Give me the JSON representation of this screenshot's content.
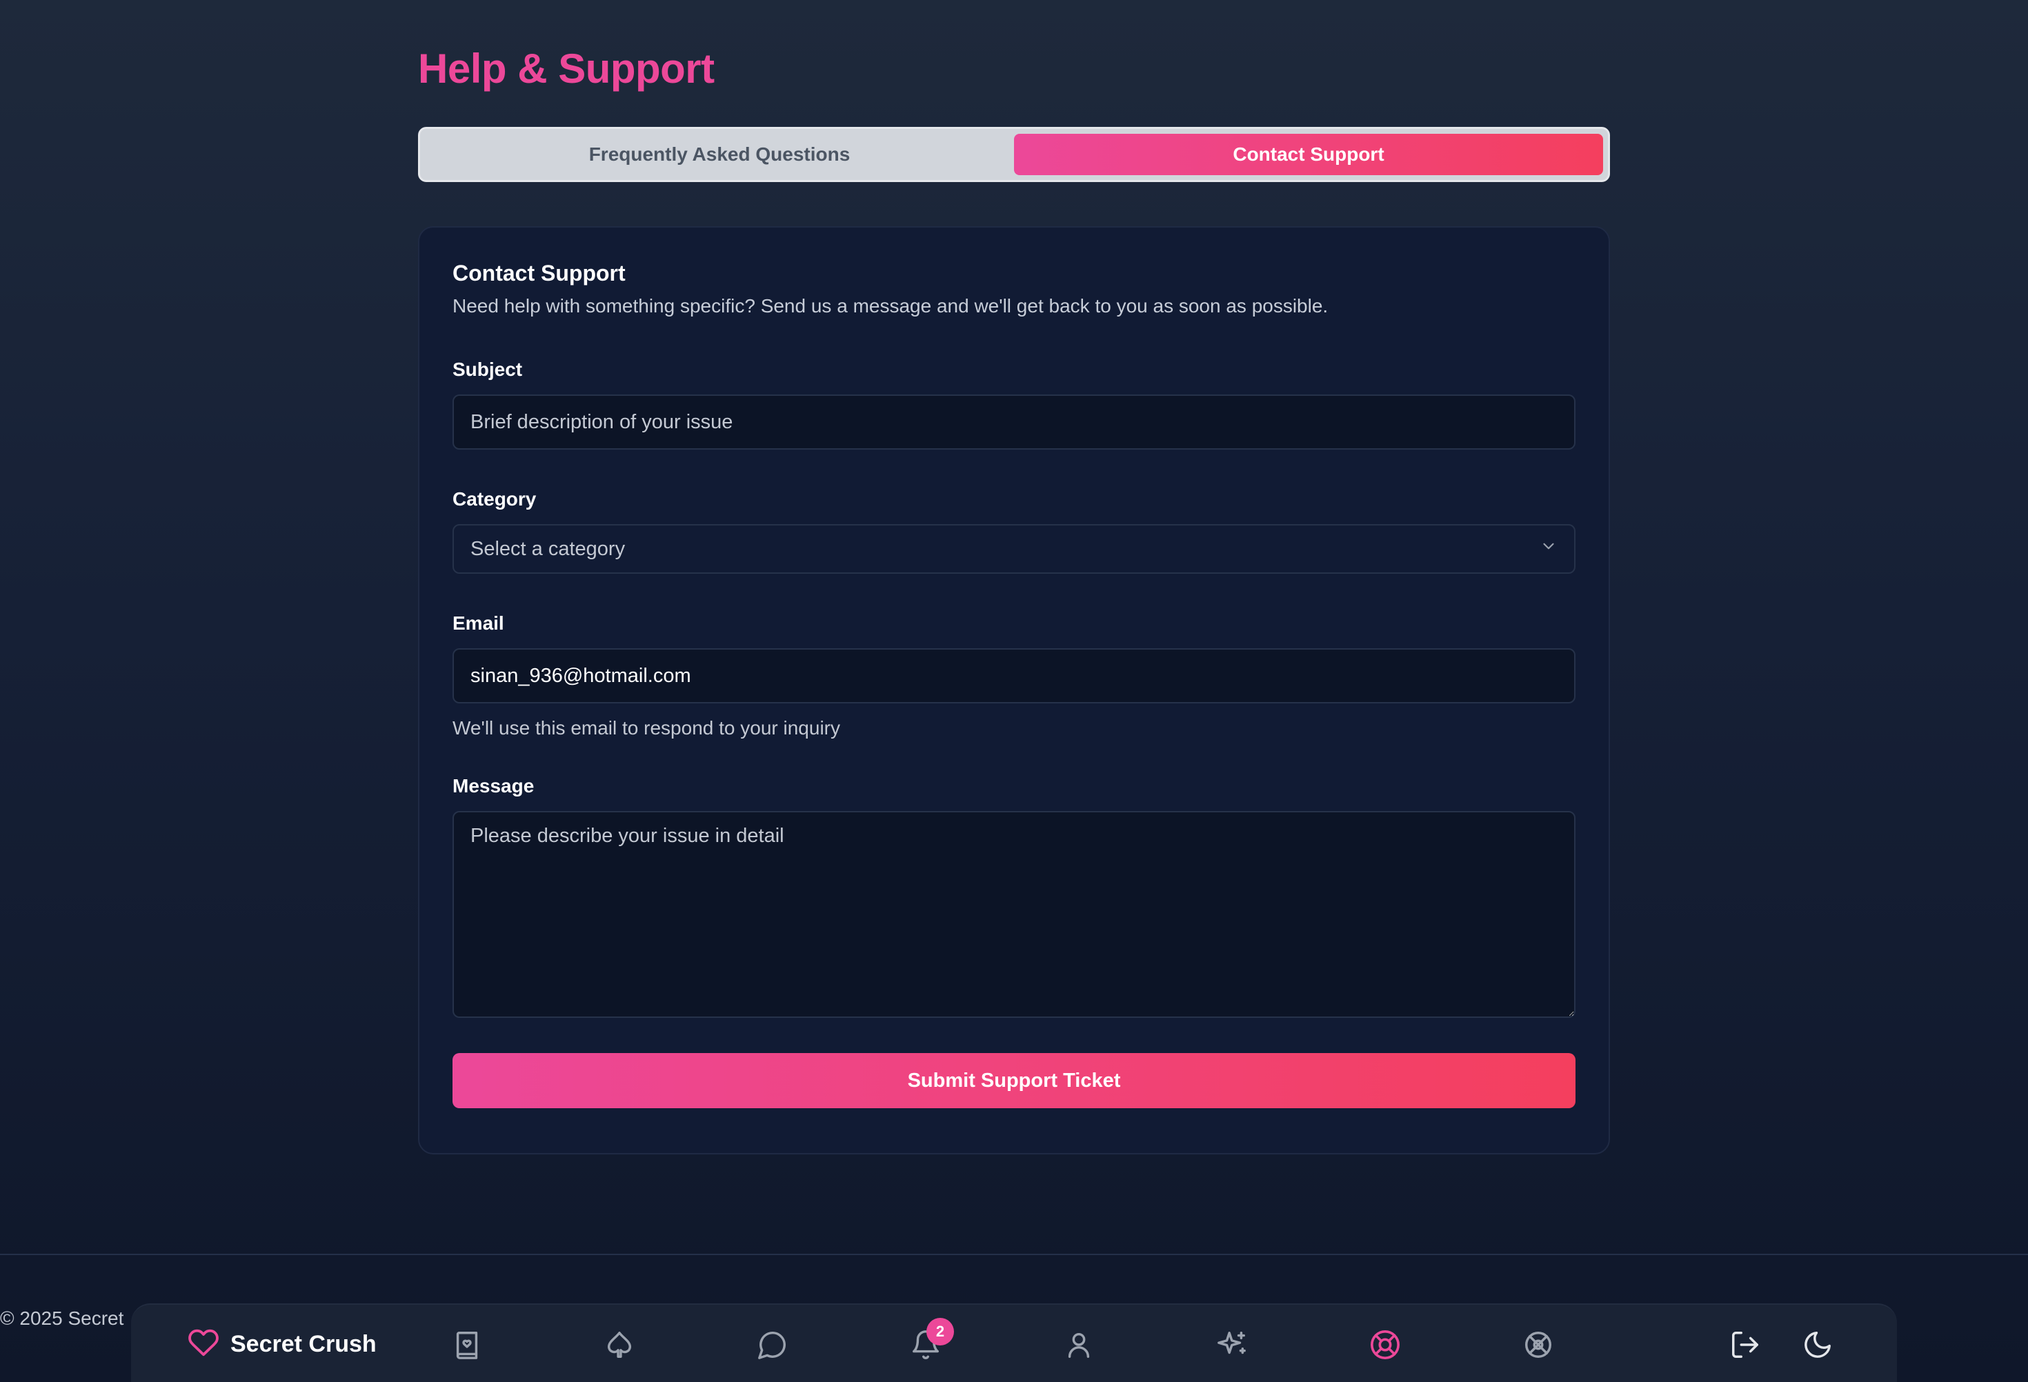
{
  "page": {
    "title": "Help & Support"
  },
  "tabs": [
    {
      "label": "Frequently Asked Questions",
      "active": false
    },
    {
      "label": "Contact Support",
      "active": true
    }
  ],
  "contact": {
    "title": "Contact Support",
    "description": "Need help with something specific? Send us a message and we'll get back to you as soon as possible.",
    "subject": {
      "label": "Subject",
      "placeholder": "Brief description of your issue",
      "value": ""
    },
    "category": {
      "label": "Category",
      "placeholder": "Select a category"
    },
    "email": {
      "label": "Email",
      "value": "sinan_936@hotmail.com",
      "hint": "We'll use this email to respond to your inquiry"
    },
    "message": {
      "label": "Message",
      "placeholder": "Please describe your issue in detail"
    },
    "submit_label": "Submit Support Ticket"
  },
  "footer": {
    "copyright": "© 2025 Secret"
  },
  "nav": {
    "brand": "Secret Crush",
    "icons": [
      "book-heart-icon",
      "spade-icon",
      "chat-bubble-icon",
      "bell-icon",
      "user-icon",
      "sparkles-icon",
      "lifebuoy-icon",
      "crossed-circle-icon",
      "logout-icon",
      "moon-icon"
    ],
    "notification_count": "2",
    "active_icon": "lifebuoy-icon"
  },
  "colors": {
    "accent": "#ec4899",
    "accent_end": "#f43f5e",
    "background": "#1e293b",
    "card": "#111b34"
  }
}
